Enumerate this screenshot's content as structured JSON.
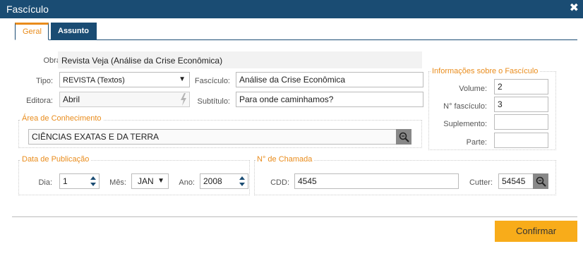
{
  "window": {
    "title": "Fascículo",
    "close_symbol": "✖"
  },
  "tabs": [
    {
      "label": "Geral"
    },
    {
      "label": "Assunto"
    }
  ],
  "geral": {
    "obra_label": "Obra:",
    "obra_value": "Revista Veja (Análise da Crise Econômica)",
    "tipo_label": "Tipo:",
    "tipo_value": "REVISTA (Textos)",
    "fasciculo_label": "Fascículo:",
    "fasciculo_value": "Análise da Crise Econômica",
    "editora_label": "Editora:",
    "editora_value": "Abril",
    "subtitulo_label": "Subtítulo:",
    "subtitulo_value": "Para onde caminhamos?"
  },
  "informacoes": {
    "title": "Informações sobre o Fascículo",
    "volume_label": "Volume:",
    "volume_value": "2",
    "numero_label": "N° fascículo:",
    "numero_value": "3",
    "suplemento_label": "Suplemento:",
    "suplemento_value": "",
    "parte_label": "Parte:",
    "parte_value": ""
  },
  "area": {
    "title": "Área de Conhecimento",
    "value": "CIÊNCIAS EXATAS E DA TERRA"
  },
  "publicacao": {
    "title": "Data de Publicação",
    "dia_label": "Dia:",
    "dia_value": "1",
    "mes_label": "Mês:",
    "mes_value": "JAN",
    "ano_label": "Ano:",
    "ano_value": "2008"
  },
  "chamada": {
    "title": "N° de Chamada",
    "cdd_label": "CDD:",
    "cdd_value": "4545",
    "cutter_label": "Cutter:",
    "cutter_value": "54545"
  },
  "footer": {
    "confirm_label": "Confirmar"
  },
  "colors": {
    "titlebar": "#1a4c73",
    "accent": "#e98c1c",
    "confirm": "#f8ac1a"
  }
}
